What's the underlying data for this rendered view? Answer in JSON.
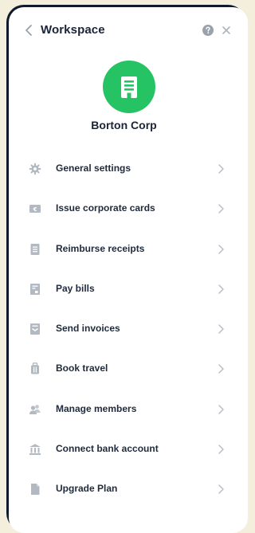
{
  "header": {
    "title": "Workspace",
    "back_icon": "chevron-left-icon",
    "help_icon": "question-circle-icon",
    "close_icon": "close-icon"
  },
  "company": {
    "name": "Borton Corp",
    "avatar_icon": "building-icon",
    "avatar_color": "#26c365"
  },
  "menu": {
    "items": [
      {
        "label": "General settings",
        "icon": "gear-icon"
      },
      {
        "label": "Issue corporate cards",
        "icon": "card-icon"
      },
      {
        "label": "Reimburse receipts",
        "icon": "receipt-icon"
      },
      {
        "label": "Pay bills",
        "icon": "bill-icon"
      },
      {
        "label": "Send invoices",
        "icon": "invoice-icon"
      },
      {
        "label": "Book travel",
        "icon": "luggage-icon"
      },
      {
        "label": "Manage members",
        "icon": "members-icon"
      },
      {
        "label": "Connect bank account",
        "icon": "bank-icon"
      },
      {
        "label": "Upgrade Plan",
        "icon": "document-icon"
      }
    ]
  },
  "colors": {
    "accent": "#26c365",
    "text": "#1a2438",
    "icon": "#b3b9c2",
    "chevron": "#b8bec7",
    "frame": "#0f1b2d",
    "background": "#f4eedc"
  }
}
